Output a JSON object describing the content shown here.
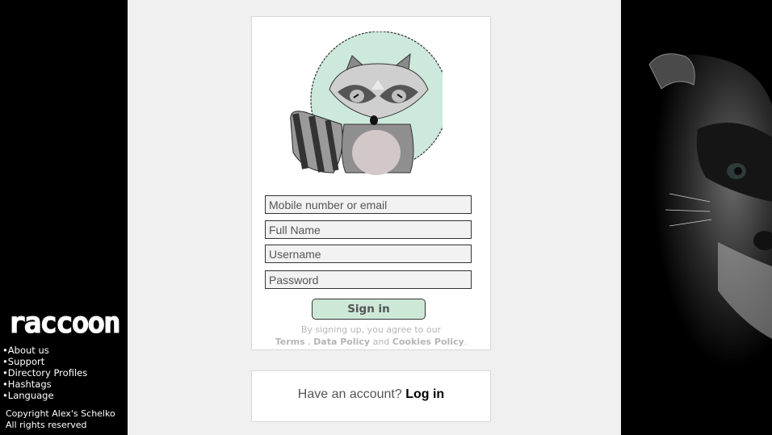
{
  "brand": {
    "logo_text": "raccoon"
  },
  "sidebar": {
    "links": [
      "About us",
      "Support",
      "Directory Profiles",
      "Hashtags",
      "Language"
    ],
    "copyright_line1": "Copyright Alex's Schelko",
    "copyright_line2": "All rights reserved"
  },
  "signup": {
    "mobile_placeholder": "Mobile number or email",
    "fullname_placeholder": "Full Name",
    "username_placeholder": "Username",
    "password_placeholder": "Password",
    "signin_label": "Sign in",
    "terms_prefix": "By signing up, you agree to our",
    "terms_link": "Terms",
    "data_policy_link": "Data Policy",
    "and_text": "and",
    "cookies_link": "Cookies Policy"
  },
  "login_card": {
    "prompt": "Have an account?",
    "login_label": "Log in"
  },
  "colors": {
    "sidebar_bg": "#000000",
    "panel_bg": "#f0f0f0",
    "button_bg": "#cde8d7",
    "mascot_circle": "#cde9dc"
  }
}
